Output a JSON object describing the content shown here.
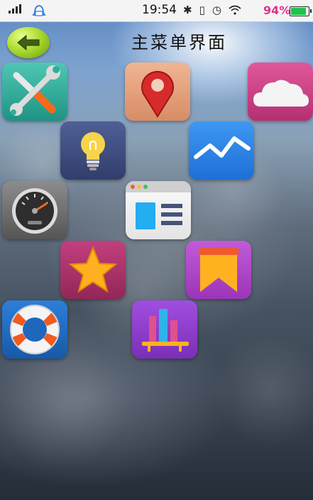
{
  "status_bar": {
    "time": "19:54",
    "battery_percent": "94%",
    "battery_level": 0.94,
    "icons": [
      "signal-icon",
      "notification-icon",
      "bluetooth-icon",
      "vibrate-icon",
      "alarm-icon",
      "wifi-icon",
      "battery-icon"
    ]
  },
  "header": {
    "title": "主菜单界面",
    "back_icon": "back-arrow-icon"
  },
  "menu_tiles": [
    {
      "name": "tools",
      "icon": "tools-icon"
    },
    {
      "name": "location",
      "icon": "map-pin-icon"
    },
    {
      "name": "cloud",
      "icon": "cloud-icon"
    },
    {
      "name": "idea",
      "icon": "lightbulb-icon"
    },
    {
      "name": "chart",
      "icon": "line-chart-icon"
    },
    {
      "name": "speed",
      "icon": "speedometer-icon"
    },
    {
      "name": "browser",
      "icon": "browser-window-icon"
    },
    {
      "name": "favorite",
      "icon": "star-icon"
    },
    {
      "name": "bookmark",
      "icon": "bookmark-icon"
    },
    {
      "name": "help",
      "icon": "lifebuoy-icon"
    },
    {
      "name": "library",
      "icon": "bookshelf-icon"
    }
  ],
  "colors": {
    "status_battery_text": "#e0338c",
    "battery_fill": "#1fc24a",
    "back_button": "#a6d72a"
  }
}
